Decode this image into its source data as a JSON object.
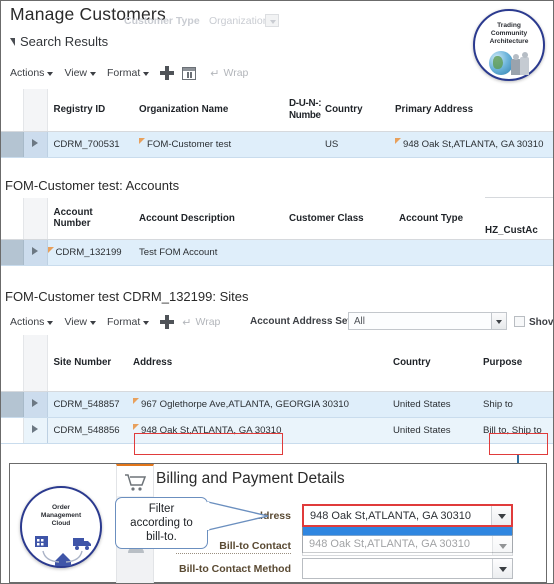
{
  "page": {
    "title": "Manage Customers",
    "ghost_filter_label": "Customer Type",
    "ghost_filter_value": "Organization",
    "search_results_label": "Search Results"
  },
  "toolbar1": {
    "actions": "Actions",
    "view": "View",
    "format": "Format",
    "add_icon": "plus-icon",
    "detach_icon": "detach-icon",
    "wrap": "Wrap"
  },
  "customers_table": {
    "columns": [
      "Registry ID",
      "Organization Name",
      "D-U-N-S Number",
      "Country",
      "Primary Address"
    ],
    "columns_clipped": [
      "Registry ID",
      "Organization Name",
      "D-U-N-:",
      "Numbe",
      "Country",
      "Primary Address"
    ],
    "rows": [
      {
        "registry_id": "CDRM_700531",
        "organization_name": "FOM-Customer test",
        "duns": "",
        "country": "US",
        "primary_address": "948 Oak St,ATLANTA, GA 30310"
      }
    ]
  },
  "accounts_section": {
    "title": "FOM-Customer test: Accounts",
    "columns": [
      "Account Number",
      "Account Description",
      "Customer Class",
      "Account Type",
      "HZ_CustAc"
    ],
    "col_account_number_l1": "Account",
    "col_account_number_l2": "Number",
    "rows": [
      {
        "account_number": "CDRM_132199",
        "account_description": "Test FOM Account",
        "customer_class": "",
        "account_type": "",
        "hz": ""
      }
    ]
  },
  "sites_section": {
    "title": "FOM-Customer test CDRM_132199: Sites",
    "toolbar": {
      "actions": "Actions",
      "view": "View",
      "format": "Format",
      "add_icon": "plus-icon",
      "wrap": "Wrap",
      "address_set_label": "Account Address Set",
      "address_set_value": "All",
      "show_label": "Shov"
    },
    "columns": [
      "Site Number",
      "Address",
      "Country",
      "Purpose"
    ],
    "rows": [
      {
        "site_number": "CDRM_548857",
        "address": "967 Oglethorpe Ave,ATLANTA, GEORGIA 30310",
        "country": "United States",
        "purpose": "Ship to"
      },
      {
        "site_number": "CDRM_548856",
        "address": "948 Oak St,ATLANTA, GA 30310",
        "country": "United States",
        "purpose": "Bill to, Ship to"
      }
    ]
  },
  "tca_logo": {
    "line1": "Trading",
    "line2": "Community",
    "line3": "Architecture"
  },
  "omc_logo": {
    "line1": "Order",
    "line2": "Management",
    "line3": "Cloud"
  },
  "billing_panel": {
    "title": "Billing and Payment Details",
    "cart_icon": "shopping-cart-icon",
    "tag_icon": "tag-icon",
    "person_icon": "person-icon",
    "fields": [
      {
        "label": "Bill-to Address",
        "value": "948 Oak St,ATLANTA, GA 30310"
      },
      {
        "label": "Bill-to Contact",
        "value": ""
      },
      {
        "label": "Bill-to Contact Method",
        "value": ""
      }
    ],
    "dropdown_options": [
      "",
      "948 Oak St,ATLANTA, GA 30310"
    ]
  },
  "annotation": {
    "callout_line1": "Filter",
    "callout_line2": "according to",
    "callout_line3": "bill-to."
  },
  "colors": {
    "highlight": "#e03b3b",
    "connector": "#2f6d9e",
    "link": "#39699e",
    "row_selected": "#dfeefa",
    "accent_orange": "#e2761a"
  }
}
